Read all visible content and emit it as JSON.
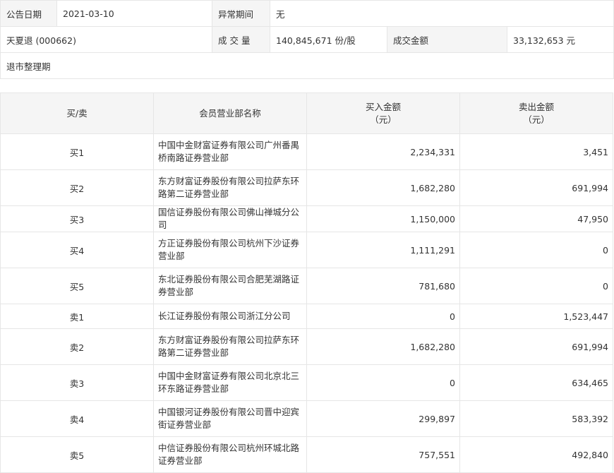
{
  "info": {
    "date_label": "公告日期",
    "date_value": "2021-03-10",
    "abnormal_label": "异常期间",
    "abnormal_value": "无",
    "stock_name": "天夏退 (000662)",
    "volume_label": "成 交 量",
    "volume_value": "140,845,671 份/股",
    "amount_label": "成交金额",
    "amount_value": "33,132,653 元",
    "reason": "退市整理期"
  },
  "table": {
    "headers": {
      "side": "买/卖",
      "name": "会员营业部名称",
      "buy_line1": "买入金额",
      "buy_line2": "（元）",
      "sell_line1": "卖出金额",
      "sell_line2": "（元）"
    },
    "rows": [
      {
        "side": "买1",
        "name": "中国中金财富证券有限公司广州番禺桥南路证券营业部",
        "buy": "2,234,331",
        "sell": "3,451"
      },
      {
        "side": "买2",
        "name": "东方财富证券股份有限公司拉萨东环路第二证券营业部",
        "buy": "1,682,280",
        "sell": "691,994"
      },
      {
        "side": "买3",
        "name": "国信证券股份有限公司佛山禅城分公司",
        "buy": "1,150,000",
        "sell": "47,950"
      },
      {
        "side": "买4",
        "name": "方正证券股份有限公司杭州下沙证券营业部",
        "buy": "1,111,291",
        "sell": "0"
      },
      {
        "side": "买5",
        "name": "东北证券股份有限公司合肥芜湖路证券营业部",
        "buy": "781,680",
        "sell": "0"
      },
      {
        "side": "卖1",
        "name": "长江证券股份有限公司浙江分公司",
        "buy": "0",
        "sell": "1,523,447"
      },
      {
        "side": "卖2",
        "name": "东方财富证券股份有限公司拉萨东环路第二证券营业部",
        "buy": "1,682,280",
        "sell": "691,994"
      },
      {
        "side": "卖3",
        "name": "中国中金财富证券有限公司北京北三环东路证券营业部",
        "buy": "0",
        "sell": "634,465"
      },
      {
        "side": "卖4",
        "name": "中国银河证券股份有限公司晋中迎宾街证券营业部",
        "buy": "299,897",
        "sell": "583,392"
      },
      {
        "side": "卖5",
        "name": "中信证券股份有限公司杭州环城北路证券营业部",
        "buy": "757,551",
        "sell": "492,840"
      }
    ]
  }
}
